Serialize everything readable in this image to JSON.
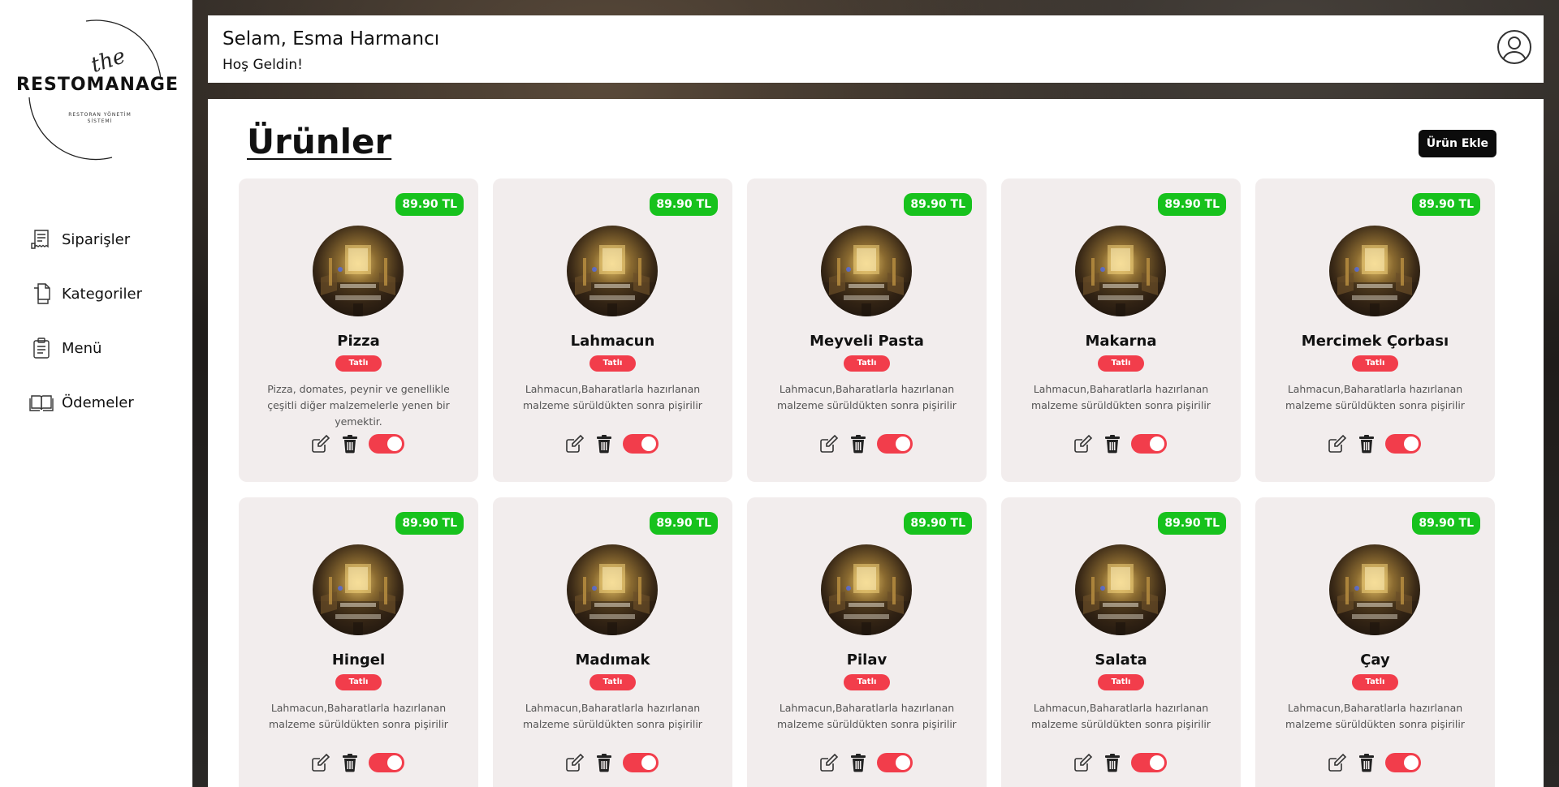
{
  "sidebar": {
    "logo": {
      "script": "the",
      "main": "RESTOMANAGE",
      "sub": "RESTORAN YÖNETİM SİSTEMİ"
    },
    "items": [
      {
        "label": "Siparişler",
        "icon": "orders-receipt-icon"
      },
      {
        "label": "Kategoriler",
        "icon": "categories-files-icon"
      },
      {
        "label": "Menü",
        "icon": "menu-clipboard-icon"
      },
      {
        "label": "Ödemeler",
        "icon": "payments-book-icon"
      }
    ]
  },
  "header": {
    "greeting": "Selam, Esma Harmancı",
    "welcome": "Hoş Geldin!",
    "user_icon": "user-circle-icon"
  },
  "main": {
    "title": "Ürünler",
    "add_label": "Ürün Ekle",
    "products": [
      {
        "name": "Pizza",
        "price": "89.90 TL",
        "category": "Tatlı",
        "description": "Pizza, domates, peynir ve genellikle çeşitli diğer malzemelerle yenen bir yemektir.",
        "active": true
      },
      {
        "name": "Lahmacun",
        "price": "89.90 TL",
        "category": "Tatlı",
        "description": "Lahmacun,Baharatlarla hazırlanan malzeme sürüldükten sonra pişirilir",
        "active": true
      },
      {
        "name": "Meyveli Pasta",
        "price": "89.90 TL",
        "category": "Tatlı",
        "description": "Lahmacun,Baharatlarla hazırlanan malzeme sürüldükten sonra pişirilir",
        "active": true
      },
      {
        "name": "Makarna",
        "price": "89.90 TL",
        "category": "Tatlı",
        "description": "Lahmacun,Baharatlarla hazırlanan malzeme sürüldükten sonra pişirilir",
        "active": true
      },
      {
        "name": "Mercimek Çorbası",
        "price": "89.90 TL",
        "category": "Tatlı",
        "description": "Lahmacun,Baharatlarla hazırlanan malzeme sürüldükten sonra pişirilir",
        "active": true
      },
      {
        "name": "Hingel",
        "price": "89.90 TL",
        "category": "Tatlı",
        "description": "Lahmacun,Baharatlarla hazırlanan malzeme sürüldükten sonra pişirilir",
        "active": true
      },
      {
        "name": "Madımak",
        "price": "89.90 TL",
        "category": "Tatlı",
        "description": "Lahmacun,Baharatlarla hazırlanan malzeme sürüldükten sonra pişirilir",
        "active": true
      },
      {
        "name": "Pilav",
        "price": "89.90 TL",
        "category": "Tatlı",
        "description": "Lahmacun,Baharatlarla hazırlanan malzeme sürüldükten sonra pişirilir",
        "active": true
      },
      {
        "name": "Salata",
        "price": "89.90 TL",
        "category": "Tatlı",
        "description": "Lahmacun,Baharatlarla hazırlanan malzeme sürüldükten sonra pişirilir",
        "active": true
      },
      {
        "name": "Çay",
        "price": "89.90 TL",
        "category": "Tatlı",
        "description": "Lahmacun,Baharatlarla hazırlanan malzeme sürüldükten sonra pişirilir",
        "active": true
      }
    ]
  },
  "colors": {
    "price_badge": "#17c21d",
    "category_badge": "#f23d4b",
    "toggle_on": "#f23d4b",
    "card_bg": "#f2eded",
    "button_dark": "#0c0c0c"
  }
}
